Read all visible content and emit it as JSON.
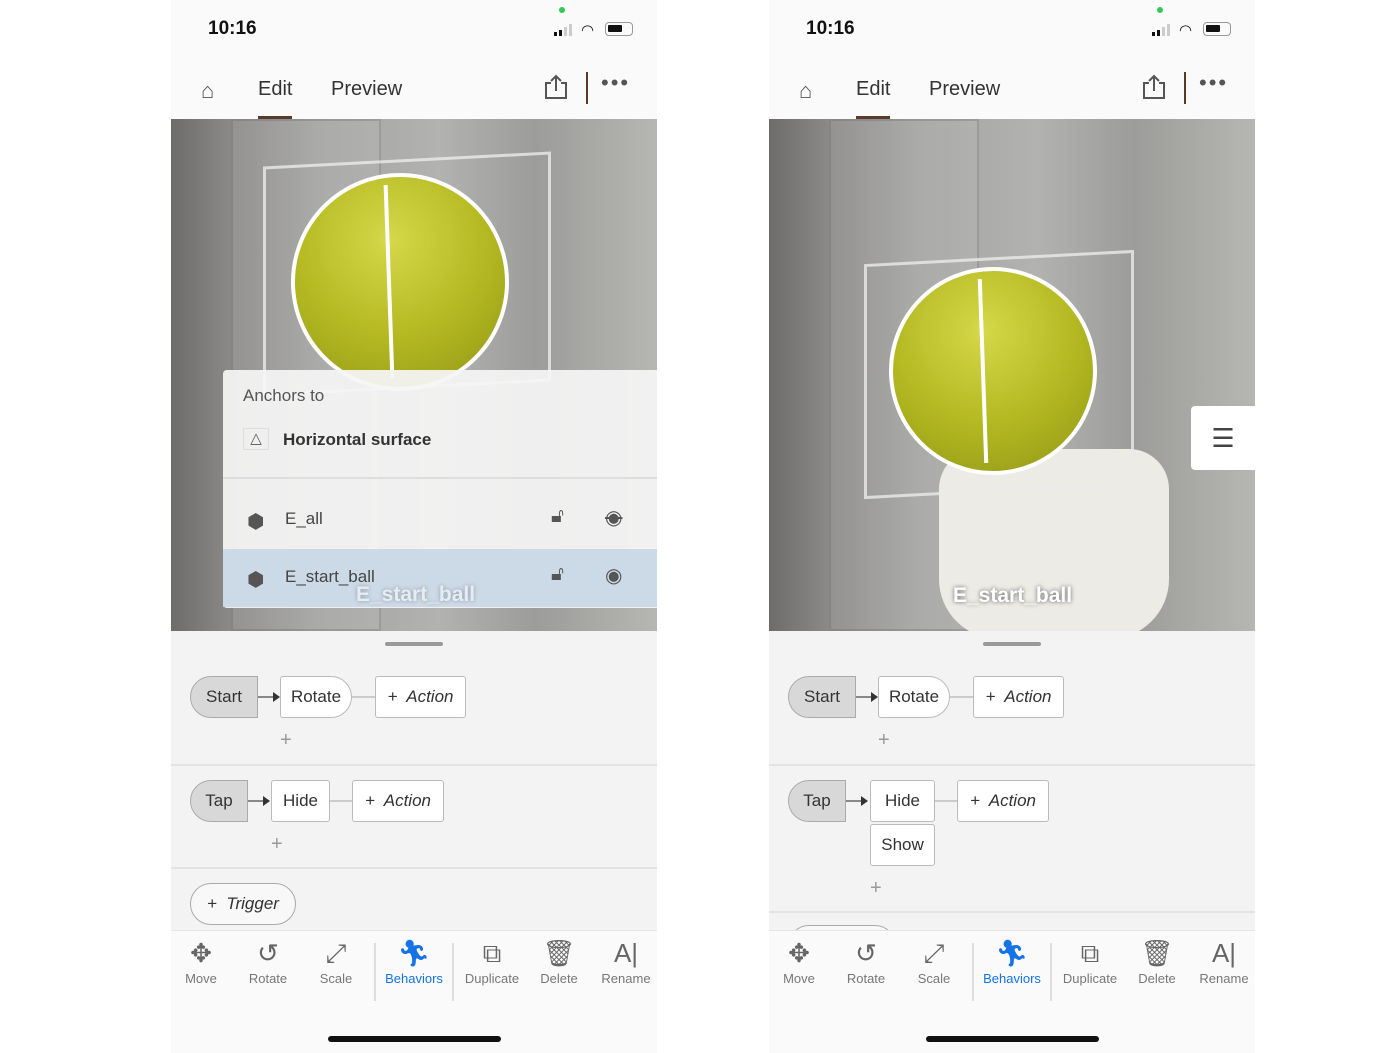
{
  "status_bar": {
    "time": "10:16"
  },
  "nav": {
    "tabs": [
      {
        "label": "Edit",
        "active": true
      },
      {
        "label": "Preview",
        "active": false
      }
    ],
    "icons": [
      "home-icon",
      "share-icon",
      "more-icon"
    ]
  },
  "scene": {
    "object_label": "E_start_ball"
  },
  "anchor_panel": {
    "heading": "Anchors to",
    "surface": "Horizontal surface",
    "items": [
      {
        "name": "E_all",
        "locked": false,
        "visible": false
      },
      {
        "name": "E_start_ball",
        "locked": false,
        "visible": true,
        "selected": true
      }
    ]
  },
  "behaviors_left": {
    "rows": [
      {
        "trigger": "Start",
        "actions": [
          "Rotate"
        ],
        "add_action": "Action"
      },
      {
        "trigger": "Tap",
        "actions": [
          "Hide"
        ],
        "add_action": "Action"
      }
    ],
    "add_trigger": "Trigger"
  },
  "behaviors_right": {
    "rows": [
      {
        "trigger": "Start",
        "actions": [
          "Rotate"
        ],
        "add_action": "Action"
      },
      {
        "trigger": "Tap",
        "actions": [
          "Hide",
          "Show"
        ],
        "add_action": "Action"
      }
    ]
  },
  "toolbar": {
    "items": [
      {
        "label": "Move",
        "icon": "move-icon"
      },
      {
        "label": "Rotate",
        "icon": "rotate-icon"
      },
      {
        "label": "Scale",
        "icon": "scale-icon"
      },
      {
        "label": "Behaviors",
        "icon": "behaviors-icon",
        "active": true
      },
      {
        "label": "Duplicate",
        "icon": "duplicate-icon"
      },
      {
        "label": "Delete",
        "icon": "delete-icon"
      },
      {
        "label": "Rename",
        "icon": "rename-icon"
      }
    ]
  },
  "colors": {
    "accent": "#1473e6",
    "tab_underline": "#5a3a2a",
    "ball": "#b5ba22"
  }
}
